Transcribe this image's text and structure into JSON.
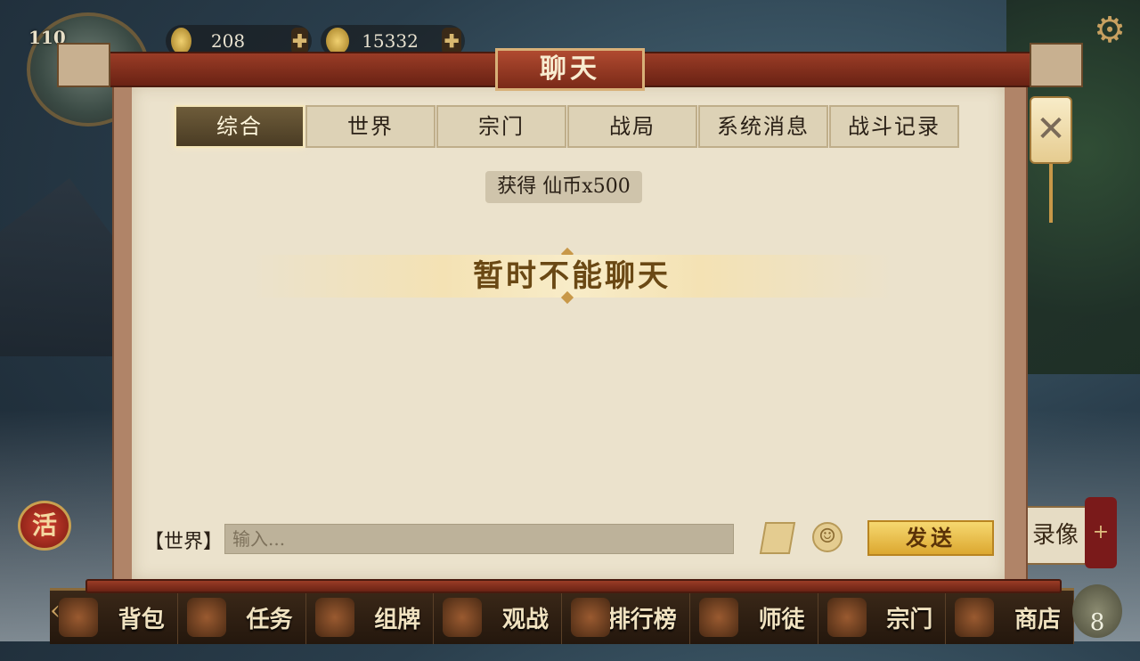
{
  "hud": {
    "level": "110",
    "gold_amount": "208",
    "coin_amount": "15332",
    "plus_glyph": "✚",
    "settings_glyph": "⚙"
  },
  "modal": {
    "title": "聊天",
    "tabs": [
      {
        "label": "综合",
        "active": true
      },
      {
        "label": "世界",
        "active": false
      },
      {
        "label": "宗门",
        "active": false
      },
      {
        "label": "战局",
        "active": false
      },
      {
        "label": "系统消息",
        "active": false
      },
      {
        "label": "战斗记录",
        "active": false
      }
    ],
    "notice": "获得 仙币x500",
    "banner": "暂时不能聊天",
    "channel_label": "【世界】",
    "input_placeholder": "输入...",
    "send_label": "发送",
    "close_glyph": "✕",
    "emoji_glyph": "☺"
  },
  "side": {
    "activity_label": "活",
    "replay_label": "录像",
    "replay_plus": "+"
  },
  "bottom_nav": {
    "items": [
      "背包",
      "任务",
      "组牌",
      "观战",
      "排行榜",
      "师徒",
      "宗门",
      "商店"
    ],
    "badge": "8",
    "arrow": "‹"
  }
}
